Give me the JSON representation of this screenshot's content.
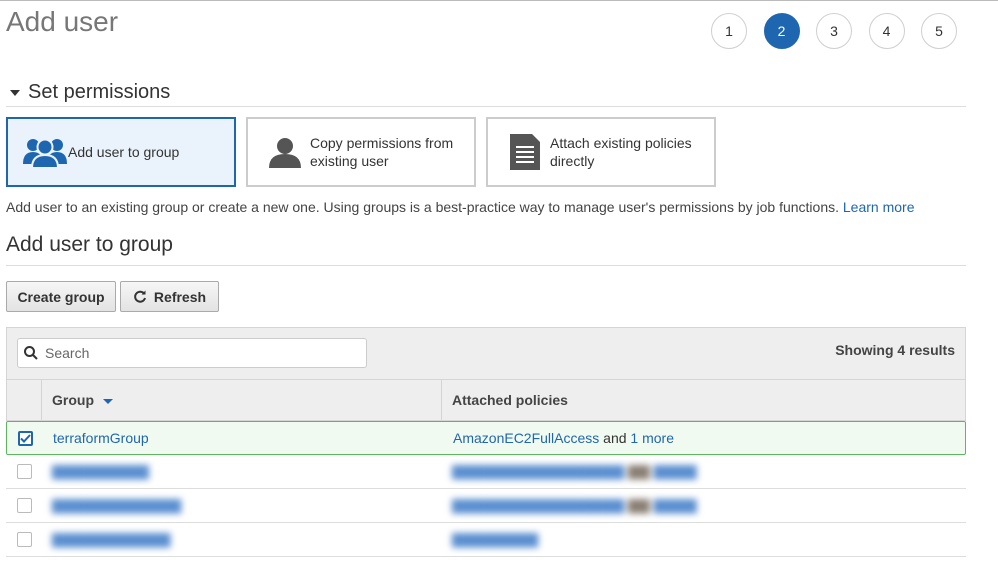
{
  "page": {
    "title": "Add user",
    "steps": [
      "1",
      "2",
      "3",
      "4",
      "5"
    ],
    "active_step": 2
  },
  "permissions": {
    "section_title": "Set permissions",
    "options": [
      {
        "label": "Add user to group",
        "icon": "users-group-icon",
        "selected": true
      },
      {
        "label": "Copy permissions from existing user",
        "icon": "user-icon",
        "selected": false
      },
      {
        "label": "Attach existing policies directly",
        "icon": "document-icon",
        "selected": false
      }
    ],
    "help_text": "Add user to an existing group or create a new one. Using groups is a best-practice way to manage user's permissions by job functions.",
    "learn_more": "Learn more"
  },
  "group": {
    "title": "Add user to group",
    "create_button": "Create group",
    "refresh_button": "Refresh",
    "search_placeholder": "Search",
    "results_text": "Showing 4 results",
    "columns": {
      "group": "Group",
      "policies": "Attached policies"
    },
    "rows": [
      {
        "group": "terraformGroup",
        "policy": "AmazonEC2FullAccess",
        "and": "and",
        "more": "1 more",
        "checked": true,
        "redacted": false
      },
      {
        "group": "",
        "policy": "",
        "and": "",
        "more": "",
        "checked": false,
        "redacted": true
      },
      {
        "group": "",
        "policy": "",
        "and": "",
        "more": "",
        "checked": false,
        "redacted": true
      },
      {
        "group": "",
        "policy": "",
        "and": "",
        "more": "",
        "checked": false,
        "redacted": true
      }
    ]
  },
  "colors": {
    "accent": "#1f66b1",
    "selected_row_border": "#5cb85c",
    "selected_option_bg": "#eaf3fb"
  }
}
